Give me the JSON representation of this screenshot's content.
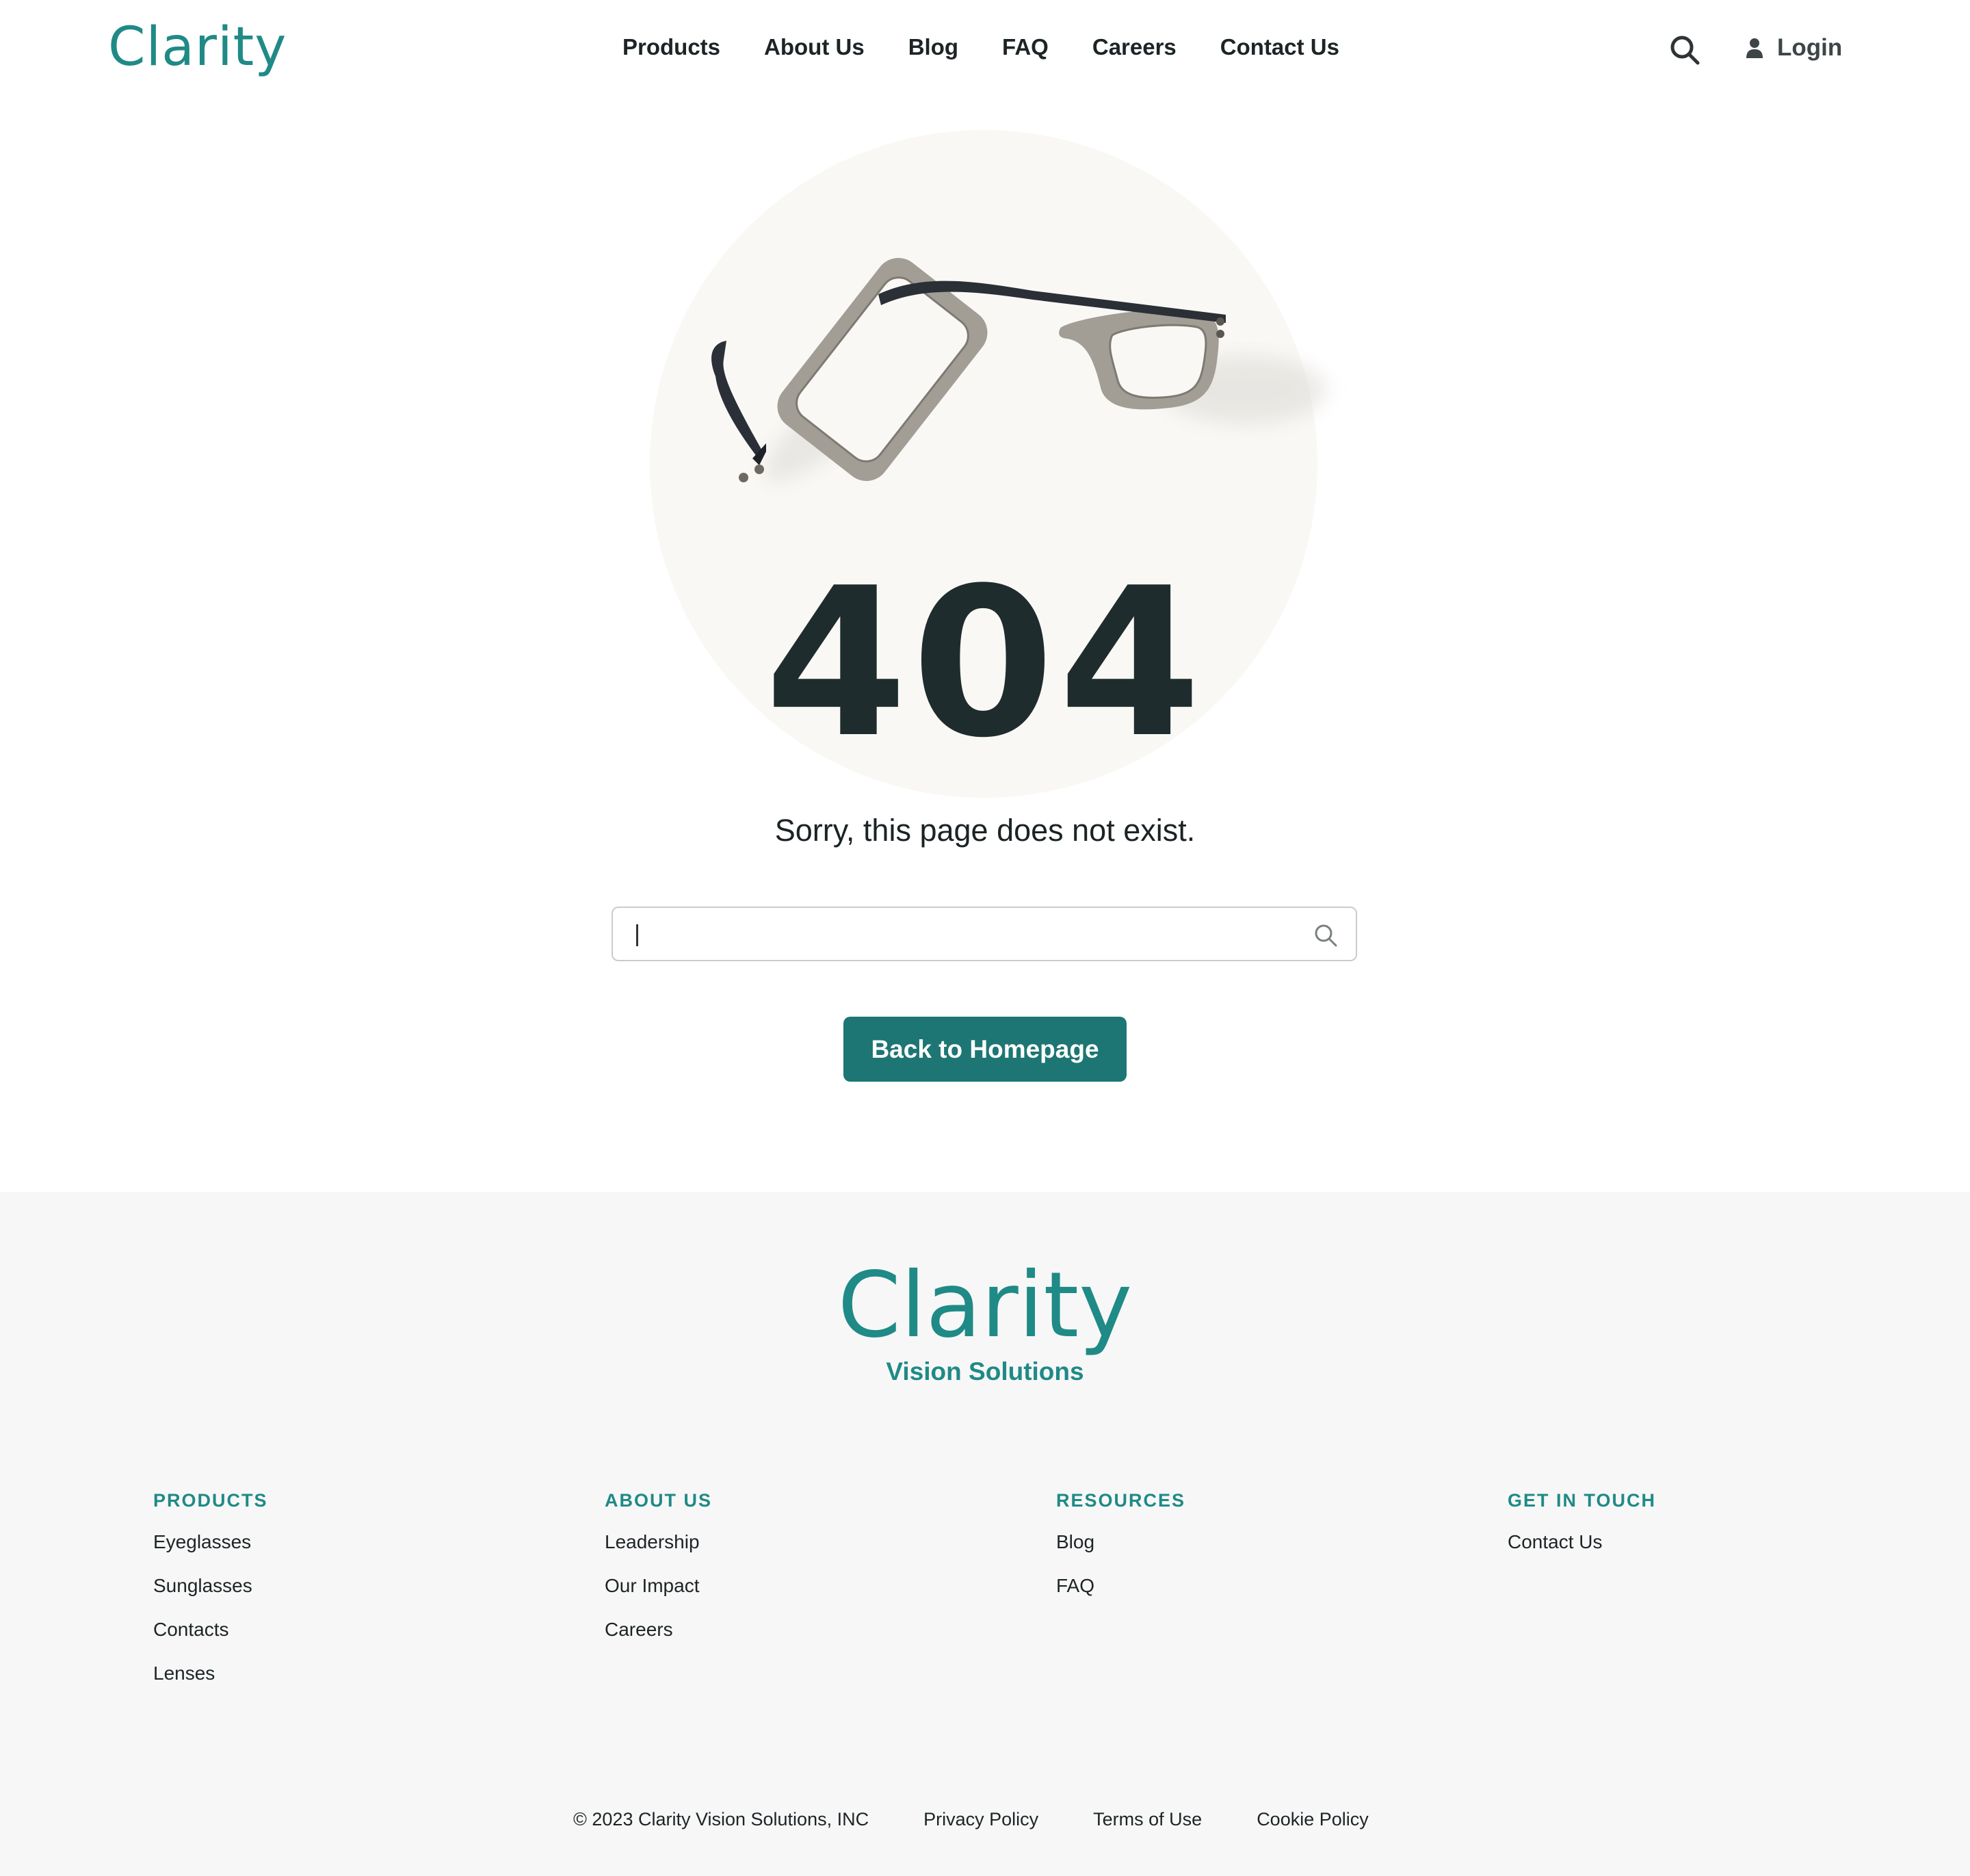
{
  "brand": {
    "name": "Clarity",
    "tagline": "Vision Solutions",
    "color": "#1f8a86"
  },
  "nav": {
    "items": [
      "Products",
      "About Us",
      "Blog",
      "FAQ",
      "Careers",
      "Contact Us"
    ],
    "login_label": "Login",
    "search_icon": "search-icon",
    "user_icon": "user-icon"
  },
  "hero": {
    "code": "404",
    "message": "Sorry, this page does not exist.",
    "search": {
      "value": "",
      "placeholder": ""
    },
    "button_label": "Back to Homepage",
    "button_color": "#1d7673"
  },
  "footer": {
    "columns": [
      {
        "title": "PRODUCTS",
        "links": [
          "Eyeglasses",
          "Sunglasses",
          "Contacts",
          "Lenses"
        ]
      },
      {
        "title": "ABOUT US",
        "links": [
          "Leadership",
          "Our Impact",
          "Careers"
        ]
      },
      {
        "title": "RESOURCES",
        "links": [
          "Blog",
          "FAQ"
        ]
      },
      {
        "title": "GET IN TOUCH",
        "links": [
          "Contact Us"
        ]
      }
    ],
    "copyright": "© 2023 Clarity Vision Solutions, INC",
    "legal": [
      "Privacy Policy",
      "Terms of Use",
      "Cookie Policy"
    ]
  }
}
